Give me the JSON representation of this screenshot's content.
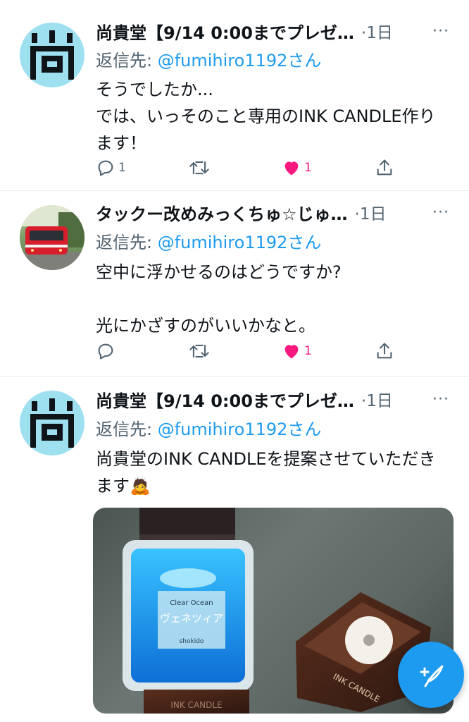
{
  "tweets": [
    {
      "name": "尚貴堂【9/14 0:00までプレゼ…",
      "time": "·1日",
      "more": "···",
      "reply_prefix": "返信先: ",
      "reply_handle": "@fumihiro1192さん",
      "text": "そうでしたか...\nでは、いっそのこと専用のINK CANDLE作ります！",
      "counts": {
        "reply": "1",
        "retweet": "",
        "like": "1"
      },
      "avatar_icon": "shokido-logo-icon"
    },
    {
      "name": "タックー改めみっくちゅ☆じゅ…",
      "time": "·1日",
      "more": "···",
      "reply_prefix": "返信先: ",
      "reply_handle": "@fumihiro1192さん",
      "text": "空中に浮かせるのはどうですか?\n\n光にかざすのがいいかなと。",
      "counts": {
        "reply": "",
        "retweet": "",
        "like": "1"
      },
      "avatar_icon": "train-photo-icon"
    },
    {
      "name": "尚貴堂【9/14 0:00までプレゼ…",
      "time": "·1日",
      "more": "···",
      "reply_prefix": "返信先: ",
      "reply_handle": "@fumihiro1192さん",
      "text": "尚貴堂のINK CANDLEを提案させていただきます🙇",
      "avatar_icon": "shokido-logo-icon",
      "media": {
        "bottle_label_1": "Clear Ocean",
        "bottle_label_2": "ヴェネツィア",
        "bottle_label_3": "shokido",
        "holder_label": "INK CANDLE",
        "base_label": "INK CANDLE"
      }
    }
  ],
  "colors": {
    "accent": "#1d9bf0",
    "like": "#f91880",
    "muted": "#536471"
  },
  "fab": {
    "icon": "compose-tweet-icon"
  }
}
